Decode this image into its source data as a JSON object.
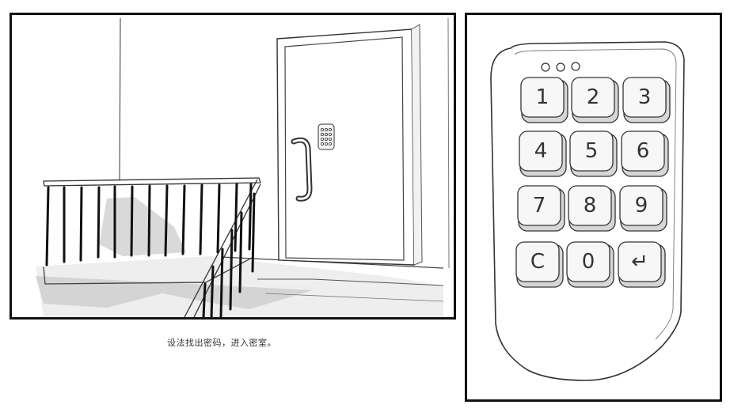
{
  "hint_text": "设法找出密码，进入密室。",
  "keypad": {
    "keys": [
      "1",
      "2",
      "3",
      "4",
      "5",
      "6",
      "7",
      "8",
      "9",
      "C",
      "0",
      "↵"
    ]
  }
}
